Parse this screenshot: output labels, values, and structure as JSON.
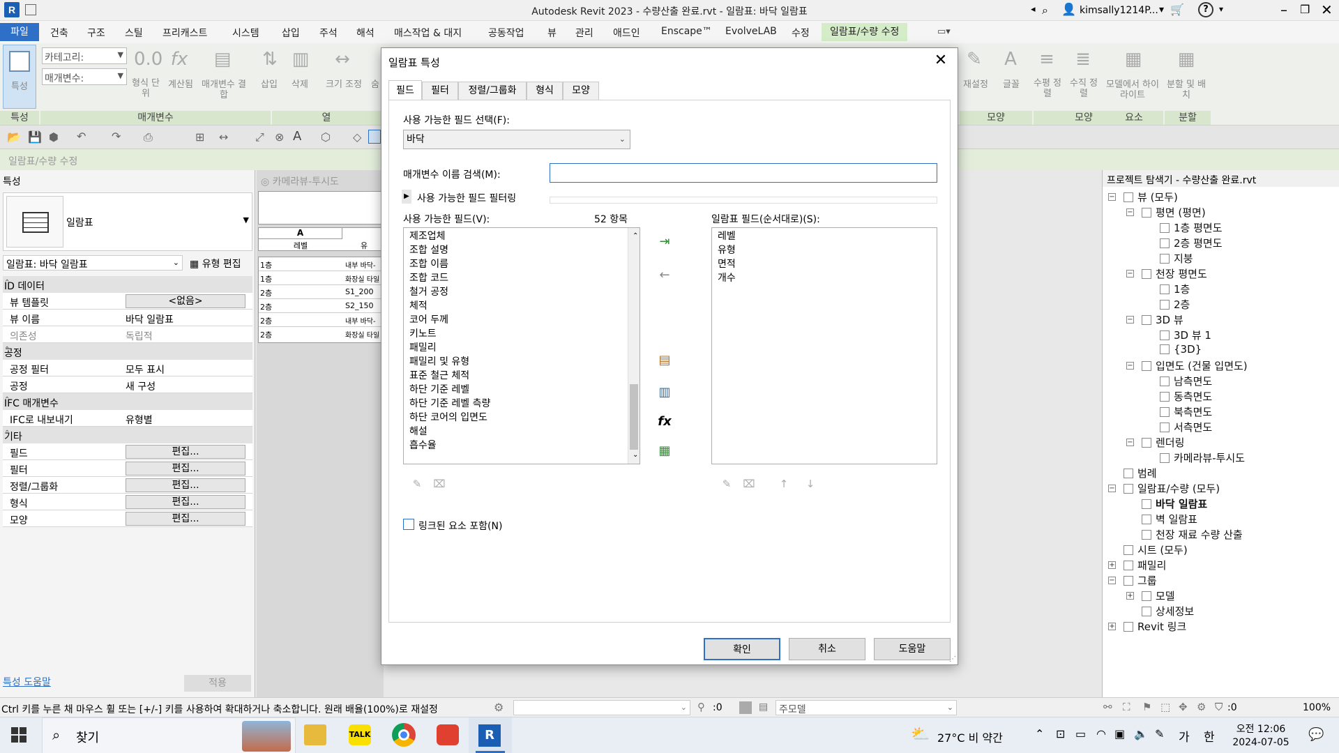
{
  "window": {
    "title": "Autodesk Revit 2023 - 수량산출 완료.rvt - 일람표: 바닥 일람표",
    "user": "kimsally1214P...",
    "logo_letter": "R"
  },
  "ribbon_tabs": [
    "파일",
    "건축",
    "구조",
    "스틸",
    "프리캐스트",
    "시스템",
    "삽입",
    "주석",
    "해석",
    "매스작업 & 대지",
    "공동작업",
    "뷰",
    "관리",
    "애드인",
    "Enscape™",
    "EvolveLAB",
    "수정",
    "일람표/수량 수정"
  ],
  "ribbon": {
    "props_label": "특성",
    "category_label": "카테고리:",
    "param_label": "매개변수:",
    "format_unit": "형식 단위",
    "calculated": "계산됨",
    "combine_params": "매개변수 결합",
    "insert": "삽입",
    "delete": "삭제",
    "resize": "크기 조정",
    "hide": "숨",
    "reset": "재설정",
    "font": "글꼴",
    "h_align": "수평 정렬",
    "v_align": "수직 정렬",
    "highlight": "모델에서 하이라이트",
    "split": "분할 및 배치",
    "group_props": "특성",
    "group_params": "매개변수",
    "group_col": "열",
    "group_style": "모양",
    "group_element": "요소",
    "group_split": "분할"
  },
  "context_bar": "일람표/수량 수정",
  "properties": {
    "title": "특성",
    "type_name": "일람표",
    "instance": "일람표: 바닥 일람표",
    "edit_type": "유형 편집",
    "sections": [
      {
        "name": "ID 데이터",
        "rows": [
          [
            "뷰 템플릿",
            "<없음>"
          ],
          [
            "뷰 이름",
            "바닥 일람표"
          ],
          [
            "의존성",
            "독립적"
          ]
        ]
      },
      {
        "name": "공정",
        "rows": [
          [
            "공정 필터",
            "모두 표시"
          ],
          [
            "공정",
            "새 구성"
          ]
        ]
      },
      {
        "name": "IFC 매개변수",
        "rows": [
          [
            "IFC로 내보내기",
            "유형별"
          ]
        ]
      },
      {
        "name": "기타",
        "rows": [
          [
            "필드",
            "편집..."
          ],
          [
            "필터",
            "편집..."
          ],
          [
            "정렬/그룹화",
            "편집..."
          ],
          [
            "형식",
            "편집..."
          ],
          [
            "모양",
            "편집..."
          ]
        ]
      }
    ],
    "help_link": "특성 도움말",
    "apply": "적용"
  },
  "schedule_view": {
    "tab": "카메라뷰-투시도",
    "col_a": "A",
    "col_a_header": "레벨",
    "col_b_header": "유",
    "rows": [
      [
        "1층",
        "내부 바닥-"
      ],
      [
        "1층",
        "화장실 타일"
      ],
      [
        "2층",
        "S1_200"
      ],
      [
        "2층",
        "S2_150"
      ],
      [
        "2층",
        "내부 바닥-"
      ],
      [
        "2층",
        "화장실 타일"
      ]
    ]
  },
  "dialog": {
    "title": "일람표 특성",
    "tabs": [
      "필드",
      "필터",
      "정렬/그룹화",
      "형식",
      "모양"
    ],
    "select_fields_label": "사용 가능한 필드 선택(F):",
    "select_value": "바닥",
    "search_label": "매개변수 이름 검색(M):",
    "search_value": "",
    "filter_toggle": "사용 가능한 필드 필터링",
    "available_label": "사용 가능한 필드(V):",
    "available_count": "52 항목",
    "available_fields": [
      "제조업체",
      "조합 설명",
      "조합 이름",
      "조합 코드",
      "철거 공정",
      "체적",
      "코어 두께",
      "키노트",
      "패밀리",
      "패밀리 및 유형",
      "표준 철근 체적",
      "하단 기준 레벨",
      "하단 기준 레벨 측량",
      "하단 코어의 입면도",
      "해설",
      "흡수율"
    ],
    "schedule_label": "일람표 필드(순서대로)(S):",
    "schedule_fields": [
      "레벨",
      "유형",
      "면적",
      "개수"
    ],
    "linked_checkbox": "링크된 요소 포함(N)",
    "linked_checked": false,
    "ok": "확인",
    "cancel": "취소",
    "help": "도움말"
  },
  "browser": {
    "title": "프로젝트 탐색기 - 수량산출 완료.rvt",
    "items": [
      {
        "label": "뷰 (모두)",
        "level": 0,
        "exp": "-"
      },
      {
        "label": "평면 (평면)",
        "level": 1,
        "exp": "-"
      },
      {
        "label": "1층 평면도",
        "level": 2,
        "exp": ""
      },
      {
        "label": "2층 평면도",
        "level": 2,
        "exp": ""
      },
      {
        "label": "지붕",
        "level": 2,
        "exp": ""
      },
      {
        "label": "천장 평면도",
        "level": 1,
        "exp": "-"
      },
      {
        "label": "1층",
        "level": 2,
        "exp": ""
      },
      {
        "label": "2층",
        "level": 2,
        "exp": ""
      },
      {
        "label": "3D 뷰",
        "level": 1,
        "exp": "-"
      },
      {
        "label": "3D 뷰 1",
        "level": 2,
        "exp": ""
      },
      {
        "label": "{3D}",
        "level": 2,
        "exp": ""
      },
      {
        "label": "입면도 (건물 입면도)",
        "level": 1,
        "exp": "-"
      },
      {
        "label": "남측면도",
        "level": 2,
        "exp": ""
      },
      {
        "label": "동측면도",
        "level": 2,
        "exp": ""
      },
      {
        "label": "북측면도",
        "level": 2,
        "exp": ""
      },
      {
        "label": "서측면도",
        "level": 2,
        "exp": ""
      },
      {
        "label": "렌더링",
        "level": 1,
        "exp": "-"
      },
      {
        "label": "카메라뷰-투시도",
        "level": 2,
        "exp": ""
      },
      {
        "label": "범례",
        "level": 0,
        "exp": ""
      },
      {
        "label": "일람표/수량 (모두)",
        "level": 0,
        "exp": "-"
      },
      {
        "label": "바닥 일람표",
        "level": 1,
        "exp": "",
        "bold": true
      },
      {
        "label": "벽 일람표",
        "level": 1,
        "exp": ""
      },
      {
        "label": "천장 재료 수량 산출",
        "level": 1,
        "exp": ""
      },
      {
        "label": "시트 (모두)",
        "level": 0,
        "exp": ""
      },
      {
        "label": "패밀리",
        "level": 0,
        "exp": "+"
      },
      {
        "label": "그룹",
        "level": 0,
        "exp": "-"
      },
      {
        "label": "모델",
        "level": 1,
        "exp": "+"
      },
      {
        "label": "상세정보",
        "level": 1,
        "exp": ""
      },
      {
        "label": "Revit 링크",
        "level": 0,
        "exp": "+"
      }
    ]
  },
  "status": {
    "message": "Ctrl 키를 누른 채 마우스 휠 또는 [+/-] 키를 사용하여 확대하거나 축소합니다. 원래 배율(100%)로 재설정",
    "count": ":0",
    "model": "주모델",
    "filter_count": ":0",
    "zoom": "100%"
  },
  "taskbar": {
    "search": "찾기",
    "weather": "27°C  비 약간",
    "ime": "가",
    "lang": "한",
    "time": "오전 12:06",
    "date": "2024-07-05"
  },
  "colors": {
    "accent": "#2e6fc7",
    "ribbon_active": "#d5ecc8",
    "context": "#e3edda"
  }
}
